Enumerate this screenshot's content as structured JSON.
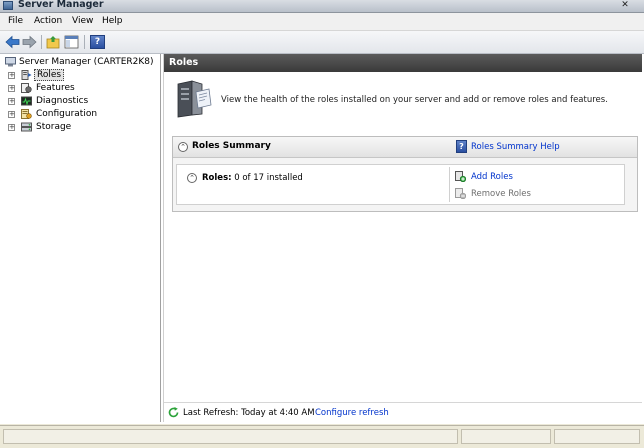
{
  "window": {
    "title": "Server Manager",
    "close_glyph": "✕"
  },
  "menu": [
    "File",
    "Action",
    "View",
    "Help"
  ],
  "toolbar": {
    "buttons": [
      "back-arrow-icon",
      "forward-arrow-icon",
      "up-folder-icon",
      "show-hide-tree-icon",
      "help-icon"
    ],
    "help_glyph": "?"
  },
  "tree": {
    "root": "Server Manager (CARTER2K8)",
    "items": [
      {
        "label": "Roles",
        "selected": true
      },
      {
        "label": "Features",
        "selected": false
      },
      {
        "label": "Diagnostics",
        "selected": false
      },
      {
        "label": "Configuration",
        "selected": false
      },
      {
        "label": "Storage",
        "selected": false
      }
    ],
    "expand_glyph": "+"
  },
  "content": {
    "header": "Roles",
    "banner_text": "View the health of the roles installed on your server and add or remove roles and features.",
    "summary": {
      "title": "Roles Summary",
      "collapse_glyph": "⌃",
      "help_link": "Roles Summary Help",
      "help_glyph": "?",
      "roles_label": "Roles:",
      "roles_value": "0 of 17 installed",
      "actions": [
        {
          "label": "Add Roles",
          "enabled": true
        },
        {
          "label": "Remove Roles",
          "enabled": false
        }
      ]
    },
    "refresh": {
      "text": "Last Refresh: Today at 4:40 AM",
      "link": "Configure refresh"
    }
  },
  "colors": {
    "header_bg": "#474747",
    "link": "#0033cc",
    "disabled": "#6e6e6e"
  }
}
